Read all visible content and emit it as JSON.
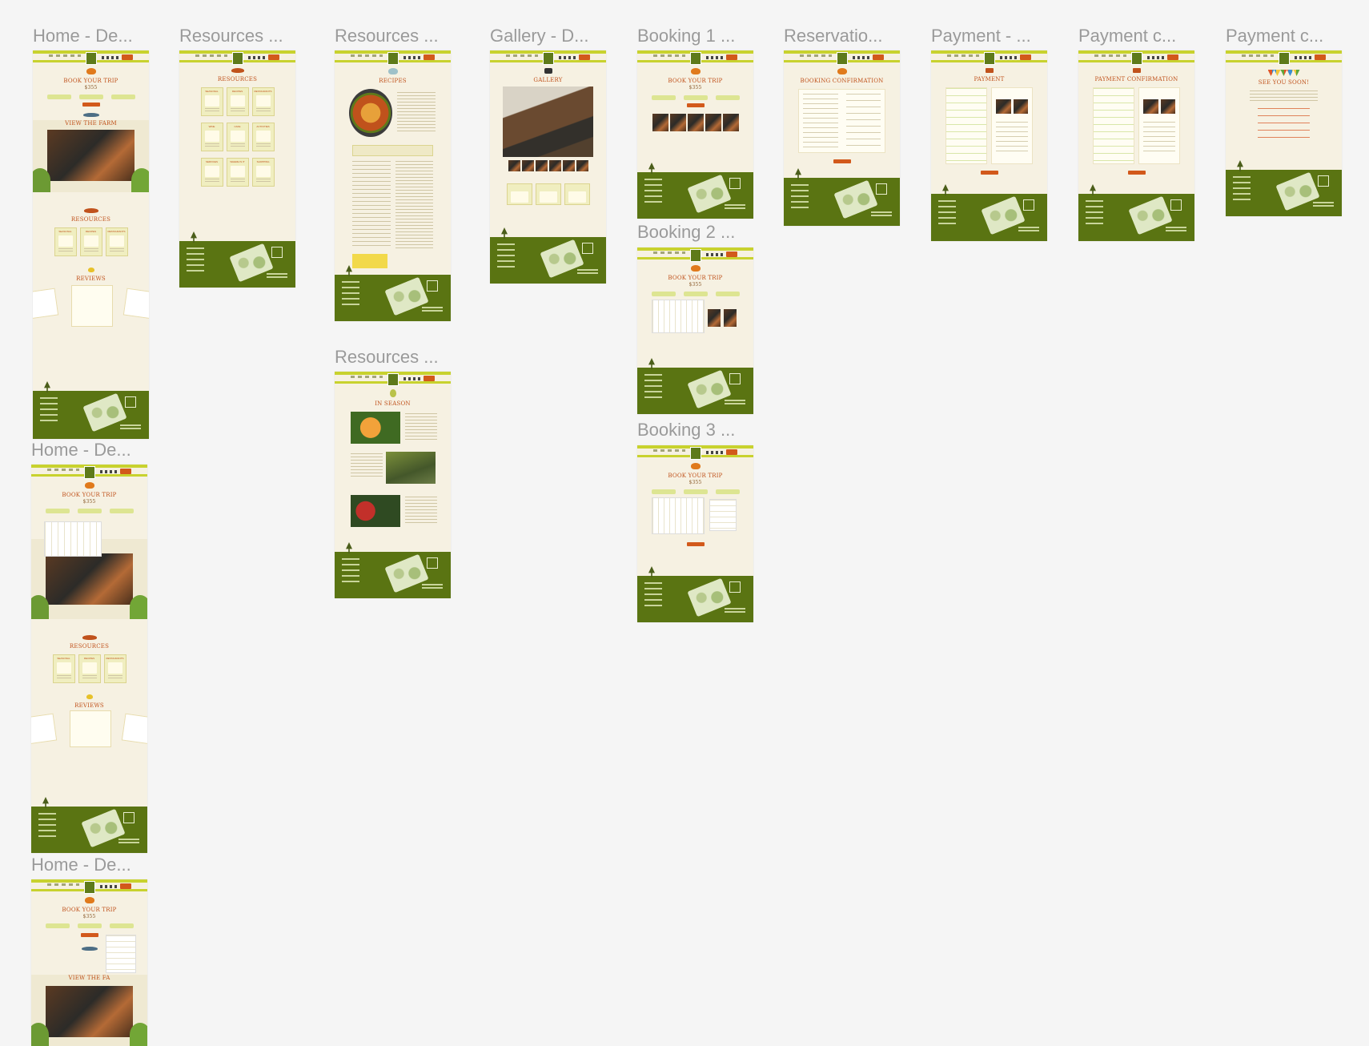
{
  "canvas": {
    "frames": [
      {
        "label": "Home - De...",
        "heading": "BOOK YOUR TRIP",
        "price": "$355",
        "second_heading": "VIEW THE FARM",
        "resources_heading": "RESOURCES",
        "reviews_heading": "REVIEWS",
        "cards": [
          "SEASONAL",
          "RECIPES",
          "RESTAURANTS"
        ]
      },
      {
        "label": "Resources ...",
        "heading": "RESOURCES",
        "cards": [
          "SEASONAL",
          "RECIPES",
          "RESTAURANTS",
          "WINE",
          "CAFE",
          "ACTIVITIES",
          "SERVICES",
          "WHERE IS IT",
          "SHOPPING"
        ]
      },
      {
        "label": "Resources ...",
        "heading": "RECIPES"
      },
      {
        "label": "Gallery - D...",
        "heading": "GALLERY"
      },
      {
        "label": "Booking 1 ...",
        "heading": "BOOK YOUR TRIP",
        "price": "$355"
      },
      {
        "label": "Reservatio...",
        "heading": "BOOKING CONFIRMATION"
      },
      {
        "label": "Payment - ...",
        "heading": "PAYMENT"
      },
      {
        "label": "Payment c...",
        "heading": "PAYMENT CONFIRMATION"
      },
      {
        "label": "Payment c...",
        "heading": "SEE YOU SOON!"
      },
      {
        "label": "Home - De...",
        "heading": "BOOK YOUR TRIP",
        "price": "$355",
        "second_heading": "VIEW THE FARM",
        "resources_heading": "RESOURCES",
        "reviews_heading": "REVIEWS",
        "cards": [
          "SEASONAL",
          "RECIPES",
          "RESTAURANTS"
        ]
      },
      {
        "label": "Home - De...",
        "heading": "BOOK YOUR TRIP",
        "price": "$355",
        "second_heading": "VIEW THE FA"
      },
      {
        "label": "Resources ...",
        "heading": "IN SEASON"
      },
      {
        "label": "Booking 2 ...",
        "heading": "BOOK YOUR TRIP",
        "price": "$355"
      },
      {
        "label": "Booking 3 ...",
        "heading": "BOOK YOUR TRIP",
        "price": "$355"
      }
    ]
  },
  "colors": {
    "canvas_bg": "#f5f5f5",
    "page_bg": "#f6f1e2",
    "nav_accent": "#c8d22e",
    "footer_green": "#5a7412",
    "heading_orange": "#c0521c",
    "button_orange": "#d2591b"
  }
}
